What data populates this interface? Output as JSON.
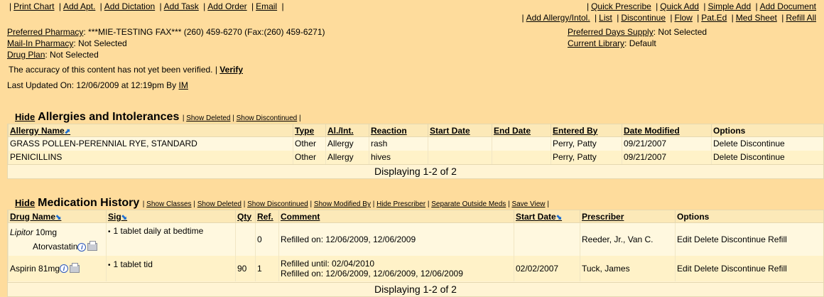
{
  "toolbar_left": [
    "Print Chart",
    "Add Apt.",
    "Add Dictation",
    "Add Task",
    "Add Order",
    "Email"
  ],
  "toolbar_right_1": [
    "Quick Prescribe",
    "Quick Add",
    "Simple Add",
    "Add Document"
  ],
  "toolbar_right_2": [
    "Add Allergy/Intol.",
    "List",
    "Discontinue",
    "Flow",
    "Pat.Ed",
    "Med Sheet",
    "Refill All"
  ],
  "pharmacy": {
    "preferred_label": "Preferred Pharmacy",
    "preferred_value": ": ***MIE-TESTING FAX*** (260) 459-6270 (Fax:(260) 459-6271)",
    "mail_label": "Mail-In Pharmacy",
    "mail_value": ": Not Selected",
    "drug_plan_label": "Drug Plan",
    "drug_plan_value": ": Not Selected",
    "days_supply_label": "Preferred Days Supply",
    "days_supply_value": ": Not Selected",
    "library_label": "Current Library",
    "library_value": ": Default"
  },
  "accuracy_text": "The accuracy of this content has not yet been verified. |",
  "verify_label": "Verify",
  "last_updated_text": "Last Updated On: 12/06/2009 at 12:19pm By",
  "last_updated_user": "IM",
  "allergies": {
    "hide_label": "Hide",
    "title": "Allergies and Intolerances",
    "links": [
      "Show Deleted",
      "Show Discontinued"
    ],
    "columns": [
      "Allergy Name",
      "Type",
      "Al./Int.",
      "Reaction",
      "Start Date",
      "End Date",
      "Entered By",
      "Date Modified",
      "Options"
    ],
    "rows": [
      {
        "name": "GRASS POLLEN-PERENNIAL RYE, STANDARD",
        "type": "Other",
        "alint": "Allergy",
        "reaction": "rash",
        "start": "",
        "end": "",
        "entered_by": "Perry, Patty",
        "modified": "09/21/2007",
        "delete": "Delete",
        "discontinue": "Discontinue"
      },
      {
        "name": "PENICILLINS",
        "type": "Other",
        "alint": "Allergy",
        "reaction": "hives",
        "start": "",
        "end": "",
        "entered_by": "Perry, Patty",
        "modified": "09/21/2007",
        "delete": "Delete",
        "discontinue": "Discontinue"
      }
    ],
    "footer": "Displaying 1-2 of 2"
  },
  "medications": {
    "hide_label": "Hide",
    "title": "Medication History",
    "links": [
      "Show Classes",
      "Show Deleted",
      "Show Discontinued",
      "Show Modified By",
      "Hide Prescriber",
      "Separate Outside Meds",
      "Save View"
    ],
    "columns": [
      "Drug Name",
      "Sig",
      "Qty",
      "Ref.",
      "Comment",
      "Start Date",
      "Prescriber",
      "Options"
    ],
    "rows": [
      {
        "drug_brand": "Lipitor",
        "drug_strength": "10mg",
        "drug_generic": "Atorvastatin",
        "sig": "1 tablet daily at bedtime",
        "qty": "",
        "ref": "0",
        "comment_1": "Refilled on: 12/06/2009, 12/06/2009",
        "comment_2": "",
        "start": "",
        "prescriber": "Reeder, Jr., Van C.",
        "edit": "Edit",
        "delete": "Delete",
        "discontinue": "Discontinue",
        "refill": "Refill"
      },
      {
        "drug_brand": "",
        "drug_strength": "Aspirin 81mg",
        "drug_generic": "",
        "sig": "1 tablet tid",
        "qty": "90",
        "ref": "1",
        "comment_1": "Refilled until: 02/04/2010",
        "comment_2": "Refilled on: 12/06/2009, 12/06/2009, 12/06/2009",
        "start": "02/02/2007",
        "prescriber": "Tuck, James",
        "edit": "Edit",
        "delete": "Delete",
        "discontinue": "Discontinue",
        "refill": "Refill"
      }
    ],
    "footer": "Displaying 1-2 of 2"
  },
  "icons": {
    "info": "info-icon",
    "print": "print-icon",
    "sort": "sort-arrow-icon"
  },
  "colors": {
    "background": "#fedc9c",
    "panel": "#fff4d4",
    "sort_arrow": "#1f6fd1",
    "info_icon": "#2a55b8"
  }
}
